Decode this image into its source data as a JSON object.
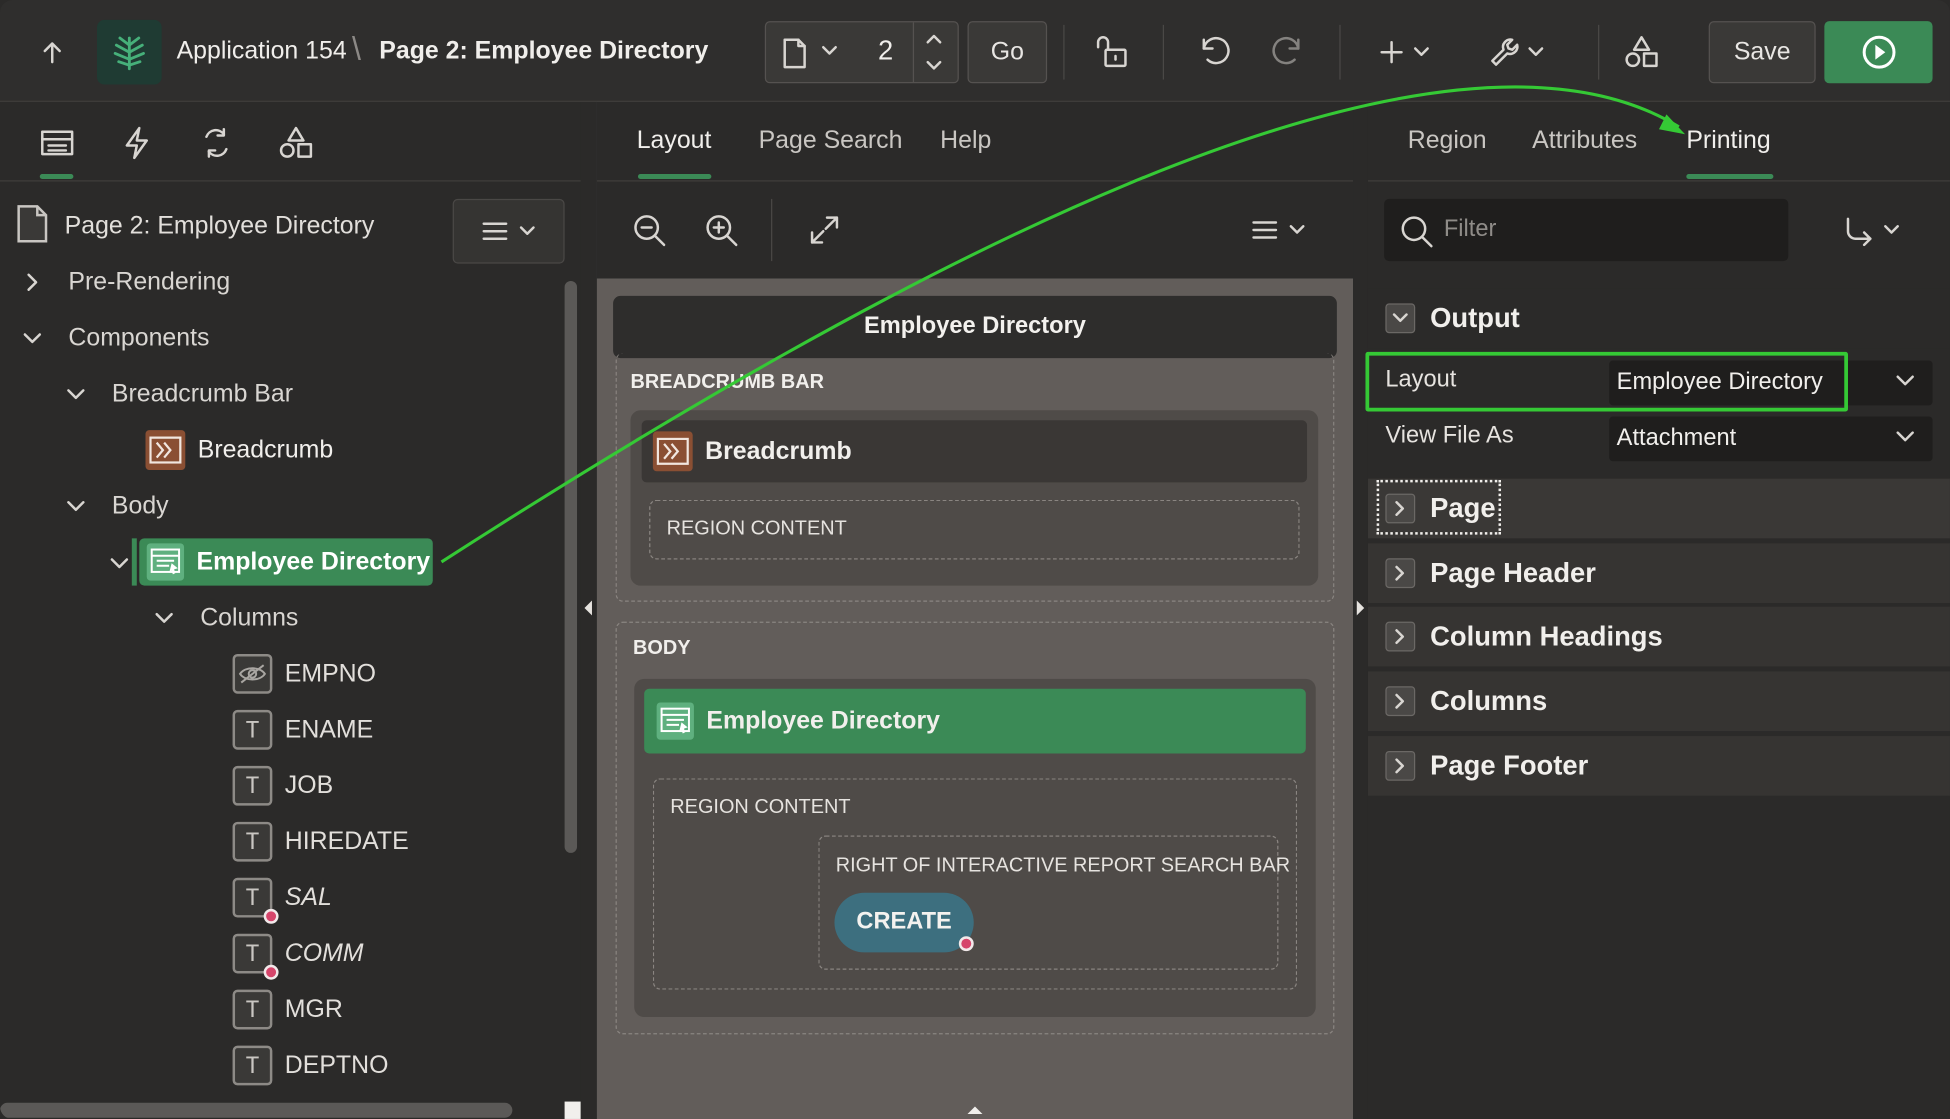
{
  "topbar": {
    "app_name": "Application 154",
    "breadcrumb_separator": "\\",
    "page_name": "Page 2: Employee Directory",
    "page_number": "2",
    "go_label": "Go",
    "save_label": "Save"
  },
  "left_panel": {
    "page_title": "Page 2: Employee Directory",
    "tree": {
      "pre_rendering": "Pre-Rendering",
      "components": "Components",
      "breadcrumb_bar": "Breadcrumb Bar",
      "breadcrumb": "Breadcrumb",
      "body": "Body",
      "employee_directory": "Employee Directory",
      "columns": "Columns",
      "column_items": [
        {
          "name": "EMPNO",
          "icon": "hidden-eye-icon"
        },
        {
          "name": "ENAME",
          "icon": "text-icon"
        },
        {
          "name": "JOB",
          "icon": "text-icon"
        },
        {
          "name": "HIREDATE",
          "icon": "text-icon"
        },
        {
          "name": "SAL",
          "icon": "text-icon",
          "italic": true
        },
        {
          "name": "COMM",
          "icon": "text-icon",
          "italic": true
        },
        {
          "name": "MGR",
          "icon": "text-icon"
        },
        {
          "name": "DEPTNO",
          "icon": "text-icon"
        }
      ]
    }
  },
  "center_panel": {
    "tabs": [
      "Layout",
      "Page Search",
      "Help"
    ],
    "active_tab": "Layout",
    "page_region_title": "Employee Directory",
    "breadcrumb_bar_label": "BREADCRUMB BAR",
    "breadcrumb_region": "Breadcrumb",
    "region_content_label": "REGION CONTENT",
    "body_label": "BODY",
    "body_region": "Employee Directory",
    "body_region_content": "REGION CONTENT",
    "search_bar_slot": "RIGHT OF INTERACTIVE REPORT SEARCH BAR",
    "create_button": "CREATE"
  },
  "right_panel": {
    "tabs": [
      "Region",
      "Attributes",
      "Printing"
    ],
    "active_tab": "Printing",
    "filter_placeholder": "Filter",
    "groups": {
      "output": "Output",
      "page": "Page",
      "page_header": "Page Header",
      "column_headings": "Column Headings",
      "columns": "Columns",
      "page_footer": "Page Footer"
    },
    "properties": [
      {
        "label": "Layout",
        "value": "Employee Directory"
      },
      {
        "label": "View File As",
        "value": "Attachment"
      }
    ]
  },
  "colors": {
    "accent_green": "#3b8a56",
    "annotation_green": "#35c935",
    "create_button": "#3d6f7f",
    "background": "#2b2a29"
  }
}
